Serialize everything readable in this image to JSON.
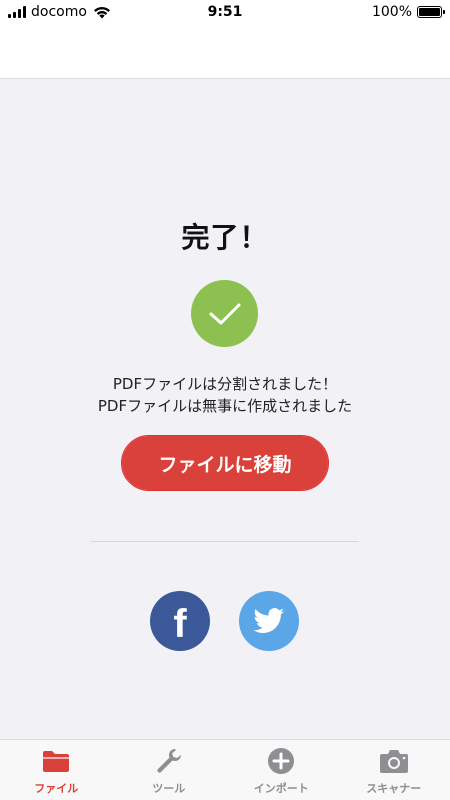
{
  "status_bar": {
    "carrier": "docomo",
    "time": "9:51",
    "battery": "100%"
  },
  "main": {
    "title": "完了！",
    "message_line1": "PDFファイルは分割されました！",
    "message_line2": "PDFファイルは無事に作成されました",
    "go_button_label": "ファイルに移動"
  },
  "social": {
    "facebook_glyph": "f"
  },
  "tabbar": {
    "tabs": [
      {
        "label": "ファイル",
        "icon": "folder-icon",
        "active": true
      },
      {
        "label": "ツール",
        "icon": "wrench-icon",
        "active": false
      },
      {
        "label": "インポート",
        "icon": "plus-circle-icon",
        "active": false
      },
      {
        "label": "スキャナー",
        "icon": "camera-icon",
        "active": false
      }
    ]
  },
  "colors": {
    "accent": "#d9413a",
    "success": "#8cc152",
    "facebook": "#3b5998",
    "twitter": "#5aa6e6",
    "background": "#f1f1f6"
  }
}
